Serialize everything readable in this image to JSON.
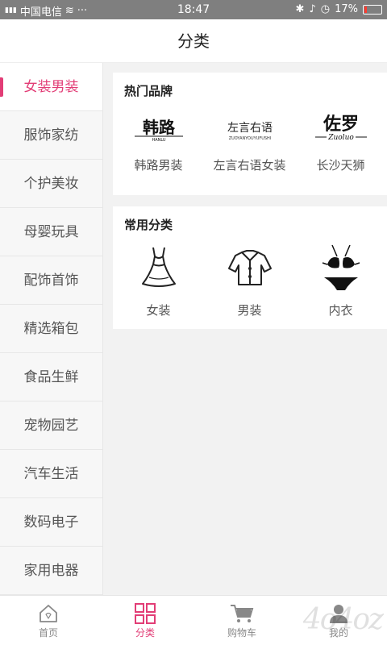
{
  "status": {
    "carrier": "中国电信",
    "time": "18:47",
    "battery": "17%",
    "battery_level": 0.17
  },
  "header": {
    "title": "分类"
  },
  "sidebar": {
    "items": [
      {
        "label": "女装男装",
        "active": true
      },
      {
        "label": "服饰家纺"
      },
      {
        "label": "个护美妆"
      },
      {
        "label": "母婴玩具"
      },
      {
        "label": "配饰首饰"
      },
      {
        "label": "精选箱包"
      },
      {
        "label": "食品生鲜"
      },
      {
        "label": "宠物园艺"
      },
      {
        "label": "汽车生活"
      },
      {
        "label": "数码电子"
      },
      {
        "label": "家用电器"
      }
    ]
  },
  "hot_brands": {
    "title": "热门品牌",
    "items": [
      {
        "label": "韩路男装",
        "logo_text": "韩路",
        "logo_sub": "HANLU"
      },
      {
        "label": "左言右语女装",
        "logo_text": "左言右语",
        "logo_sub": "ZUOYANYOUYUFUSHI"
      },
      {
        "label": "长沙天狮",
        "logo_text": "佐罗",
        "logo_sub": "Zuoluo"
      }
    ]
  },
  "common_categories": {
    "title": "常用分类",
    "items": [
      {
        "label": "女装",
        "icon": "dress-icon"
      },
      {
        "label": "男装",
        "icon": "shirt-icon"
      },
      {
        "label": "内衣",
        "icon": "bikini-icon"
      }
    ]
  },
  "bottom_nav": {
    "tabs": [
      {
        "label": "首页",
        "icon": "home-icon"
      },
      {
        "label": "分类",
        "icon": "grid-icon",
        "active": true
      },
      {
        "label": "购物车",
        "icon": "cart-icon"
      },
      {
        "label": "我的",
        "icon": "user-icon"
      }
    ]
  },
  "watermark": "4o4oz",
  "colors": {
    "accent": "#e23d76",
    "status_bar": "#7f7f7f"
  }
}
